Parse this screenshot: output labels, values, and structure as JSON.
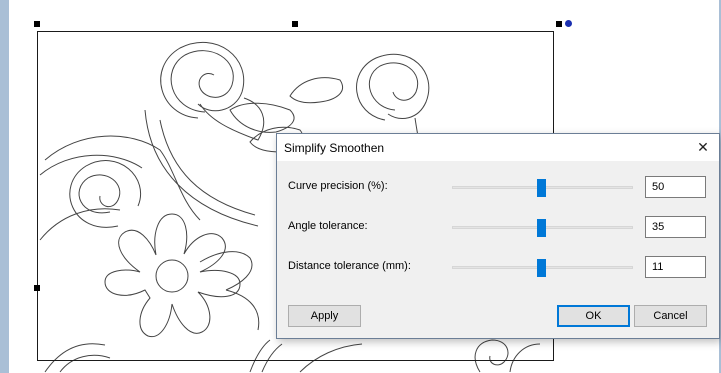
{
  "dialog": {
    "title": "Simplify Smoothen",
    "close_glyph": "✕",
    "rows": [
      {
        "label": "Curve precision (%):",
        "value": "50",
        "slider_fraction": 0.49
      },
      {
        "label": "Angle tolerance:",
        "value": "35",
        "slider_fraction": 0.49
      },
      {
        "label": "Distance tolerance (mm):",
        "value": "11",
        "slider_fraction": 0.49
      }
    ],
    "buttons": {
      "apply": "Apply",
      "ok": "OK",
      "cancel": "Cancel"
    }
  },
  "colors": {
    "accent": "#0078d7",
    "selection_handle": "#000000",
    "rotation_handle": "#1a2fb0",
    "frame": "#a9bfd6"
  },
  "icons": {
    "close": "close-icon",
    "artwork": "embroidery-floral-pattern",
    "rotation": "rotation-handle-icon"
  }
}
